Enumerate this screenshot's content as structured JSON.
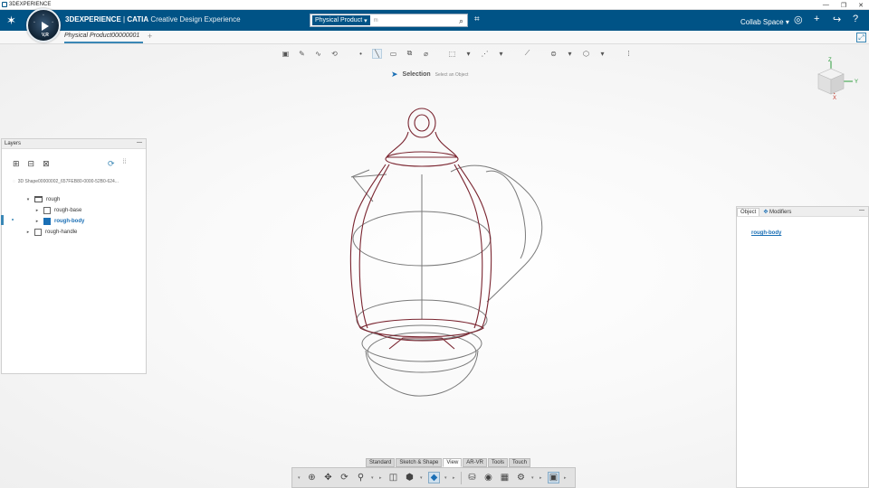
{
  "window": {
    "title": "3DEXPERIENCE",
    "controls": [
      "—",
      "❐",
      "✕"
    ]
  },
  "app": {
    "brand_main": "3DEXPERIENCE",
    "brand_sep": " | ",
    "brand_app": "CATIA",
    "brand_role": " Creative Design Experience",
    "compass_label": "V,R",
    "search": {
      "category": "Physical Product",
      "value": "m"
    },
    "collab_space": "Collab Space"
  },
  "tabs": [
    {
      "label": "Physical Product00000001"
    }
  ],
  "tab_add": "+",
  "selection": {
    "title": "Selection",
    "hint": "Select an Object"
  },
  "cube": {
    "z": "Z",
    "y": "Y",
    "x": "X"
  },
  "layers": {
    "title": "Layers",
    "minimize": "—",
    "shape": "3D Shape00000002_657FEB80-0000-52B0-624...",
    "tree": [
      {
        "label": "rough",
        "depth": 0,
        "expanded": true,
        "type": "folder"
      },
      {
        "label": "rough-base",
        "depth": 1,
        "expanded": false,
        "type": "file"
      },
      {
        "label": "rough-body",
        "depth": 1,
        "expanded": false,
        "type": "file",
        "active": true
      },
      {
        "label": "rough-handle",
        "depth": 0,
        "expanded": false,
        "type": "file"
      }
    ]
  },
  "object_panel": {
    "tab_object": "Object",
    "tab_modifiers": "Modifiers",
    "minimize": "—",
    "link": "rough-body"
  },
  "bottom_tabs": [
    "Standard",
    "Sketch & Shape",
    "View",
    "AR-VR",
    "Tools",
    "Touch"
  ],
  "active_bottom_tab": "View",
  "colors": {
    "appbar": "#005386",
    "accent": "#1a6fb5",
    "sketch_red": "#7a2530",
    "sketch_grey": "#7a7a7a"
  }
}
